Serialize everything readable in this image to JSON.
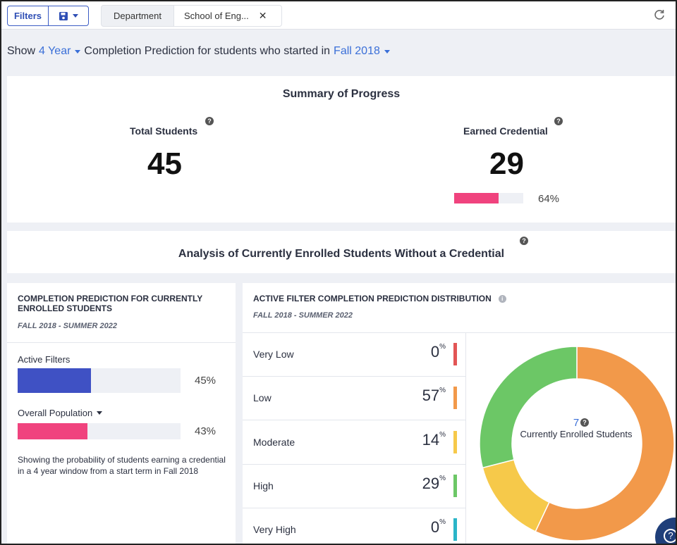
{
  "toolbar": {
    "filters_label": "Filters",
    "save_icon": "save-icon",
    "department_label": "Department",
    "department_value": "School of Eng...",
    "refresh_icon": "refresh-icon"
  },
  "headline": {
    "prefix": "Show",
    "duration": "4 Year",
    "middle": "Completion Prediction for students who started in",
    "term": "Fall 2018"
  },
  "summary": {
    "title": "Summary of Progress",
    "total_label": "Total Students",
    "total_value": "45",
    "earned_label": "Earned Credential",
    "earned_value": "29",
    "earned_pct": "64%",
    "earned_fraction": 0.64,
    "bar_color": "#f0437e"
  },
  "analysis": {
    "title": "Analysis of Currently Enrolled Students Without a Credential"
  },
  "left": {
    "title": "COMPLETION PREDICTION FOR CURRENTLY ENROLLED STUDENTS",
    "subtitle": "FALL 2018 - SUMMER 2022",
    "active_label": "Active Filters",
    "active_pct": "45%",
    "active_fraction": 0.45,
    "active_color": "#3f51c4",
    "overall_label": "Overall Population",
    "overall_pct": "43%",
    "overall_fraction": 0.43,
    "overall_color": "#f0437e",
    "description": "Showing the probability of students earning a credential in a 4 year window from a start term in Fall 2018"
  },
  "right": {
    "title": "ACTIVE FILTER COMPLETION PREDICTION DISTRIBUTION",
    "subtitle": "FALL 2018 - SUMMER 2022",
    "categories": [
      {
        "name": "Very Low",
        "value": "0",
        "color": "#e25555"
      },
      {
        "name": "Low",
        "value": "57",
        "color": "#f2994a"
      },
      {
        "name": "Moderate",
        "value": "14",
        "color": "#f6c94a"
      },
      {
        "name": "High",
        "value": "29",
        "color": "#6cc766"
      },
      {
        "name": "Very High",
        "value": "0",
        "color": "#2bb5c8"
      }
    ],
    "pct_symbol": "%",
    "donut_count": "7",
    "donut_label": "Currently Enrolled Students"
  },
  "chart_data": {
    "type": "pie",
    "categories": [
      "Very Low",
      "Low",
      "Moderate",
      "High",
      "Very High"
    ],
    "values": [
      0,
      57,
      14,
      29,
      0
    ],
    "colors": [
      "#e25555",
      "#f2994a",
      "#f6c94a",
      "#6cc766",
      "#2bb5c8"
    ],
    "title": "",
    "center_value": 7,
    "center_label": "Currently Enrolled Students"
  }
}
